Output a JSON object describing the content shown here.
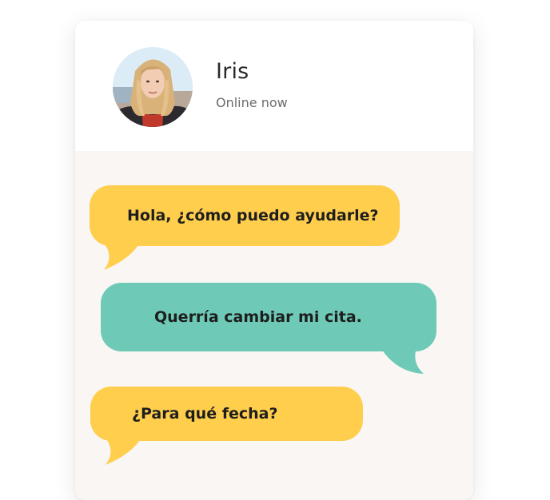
{
  "contact": {
    "name": "Iris",
    "status": "Online now"
  },
  "messages": [
    {
      "from": "agent",
      "text": "Hola, ¿cómo puedo ayudarle?"
    },
    {
      "from": "user",
      "text": "Querría cambiar mi cita."
    },
    {
      "from": "agent",
      "text": "¿Para qué fecha?"
    }
  ],
  "colors": {
    "agent_bubble": "#ffce4d",
    "user_bubble": "#6ecab6",
    "chat_background": "#f9f6f3",
    "header_background": "#ffffff"
  }
}
